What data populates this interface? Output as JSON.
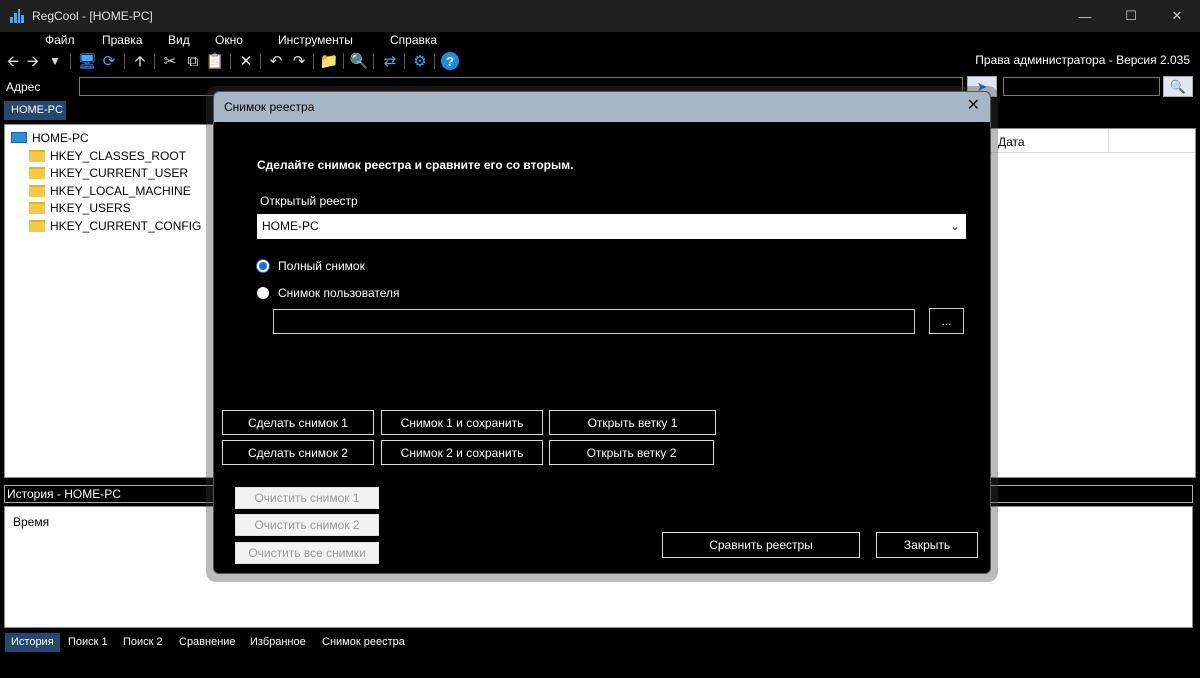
{
  "window": {
    "title": "RegCool - [HOME-PC]"
  },
  "menu": [
    "Файл",
    "Правка",
    "Вид",
    "Окно",
    "Инструменты",
    "Справка"
  ],
  "toolbar": {
    "icons": [
      "back-arrow-icon",
      "forward-arrow-icon",
      "dropdown-icon",
      "computer-icon",
      "refresh-icon",
      "up-arrow-icon",
      "cut-icon",
      "copy-icon",
      "paste-icon",
      "delete-icon",
      "undo-icon",
      "redo-icon",
      "new-key-icon",
      "find-icon",
      "compare-icon",
      "settings-icon",
      "help-icon"
    ],
    "version_text": "Права администратора - Версия 2.035"
  },
  "address": {
    "label": "Адрес",
    "value": "",
    "search_value": ""
  },
  "host_tab": "HOME-PC",
  "tree": {
    "root": "HOME-PC",
    "hives": [
      "HKEY_CLASSES_ROOT",
      "HKEY_CURRENT_USER",
      "HKEY_LOCAL_MACHINE",
      "HKEY_USERS",
      "HKEY_CURRENT_CONFIG"
    ]
  },
  "list": {
    "date_column": "Дата"
  },
  "history": {
    "title": "История - HOME-PC",
    "time_column": "Время"
  },
  "bottom_tabs": [
    "История",
    "Поиск 1",
    "Поиск 2",
    "Сравнение",
    "Избранное",
    "Снимок реестра"
  ],
  "dialog": {
    "title": "Снимок реестра",
    "heading": "Сделайте снимок реестра и сравните его со вторым.",
    "opened_registry_label": "Открытый реестр",
    "opened_registry_value": "HOME-PC",
    "radio_full": "Полный снимок",
    "radio_user": "Снимок пользователя",
    "user_path_value": "",
    "browse_label": "...",
    "buttons": {
      "snap1": "Сделать снимок 1",
      "snap2": "Сделать снимок 2",
      "snap1_save": "Снимок 1 и сохранить",
      "snap2_save": "Снимок 2 и сохранить",
      "open_branch1": "Открыть ветку 1",
      "open_branch2": "Открыть ветку 2",
      "clear1": "Очистить снимок 1",
      "clear2": "Очистить снимок 2",
      "clear_all": "Очистить все снимки",
      "compare": "Сравнить реестры",
      "close": "Закрыть"
    }
  }
}
